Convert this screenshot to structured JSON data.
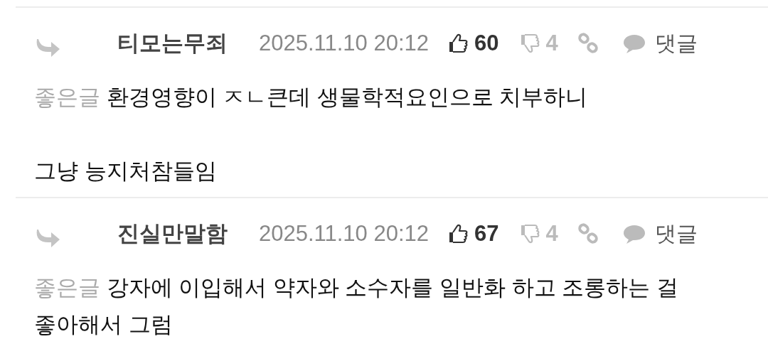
{
  "comments": [
    {
      "author": "티모는무죄",
      "date": "2025.11.10 20:12",
      "likes": "60",
      "dislikes": "4",
      "reply_label": "댓글",
      "badge": "좋은글",
      "text": "환경영향이 ㅈㄴ큰데 생물학적요인으로 치부하니\n\n그냥 능지처참들임"
    },
    {
      "author": "진실만말함",
      "date": "2025.11.10 20:12",
      "likes": "67",
      "dislikes": "4",
      "reply_label": "댓글",
      "badge": "좋은글",
      "text": "강자에 이입해서 약자와 소수자를 일반화 하고 조롱하는 걸 좋아해서 그럼"
    }
  ]
}
